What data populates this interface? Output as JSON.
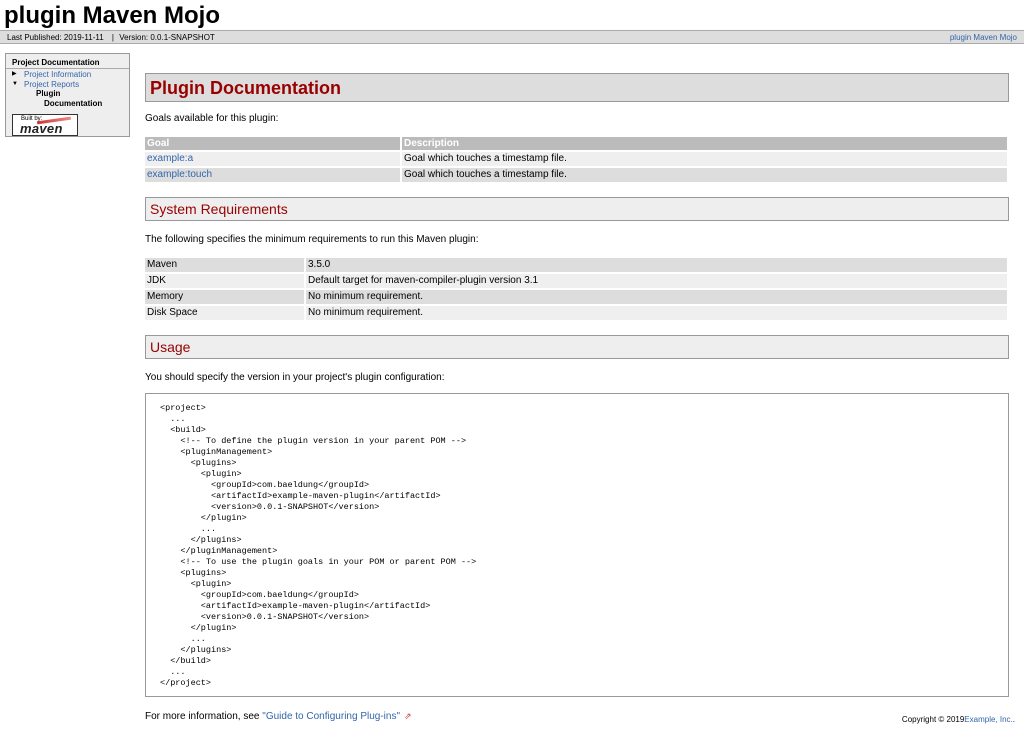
{
  "banner": {
    "title": "plugin Maven Mojo"
  },
  "breadcrumbs": {
    "published": "Last Published: 2019-11-11",
    "separator": "|",
    "version": "Version: 0.0.1-SNAPSHOT",
    "right_link": "plugin Maven Mojo"
  },
  "nav": {
    "heading": "Project Documentation",
    "items": [
      {
        "label": "Project Information",
        "expanded": false
      },
      {
        "label": "Project Reports",
        "expanded": true
      }
    ],
    "sub_line1": "Plugin",
    "sub_line2": "Documentation",
    "powered_small": "Built by:",
    "powered_big": "maven"
  },
  "content": {
    "title": "Plugin Documentation",
    "goals_intro": "Goals available for this plugin:",
    "goals_table": {
      "headers": [
        "Goal",
        "Description"
      ],
      "rows": [
        {
          "goal": "example:a",
          "description": "Goal which touches a timestamp file."
        },
        {
          "goal": "example:touch",
          "description": "Goal which touches a timestamp file."
        }
      ]
    },
    "sysreq_title": "System Requirements",
    "sysreq_intro": "The following specifies the minimum requirements to run this Maven plugin:",
    "sysreq_rows": [
      {
        "name": "Maven",
        "value": "3.5.0"
      },
      {
        "name": "JDK",
        "value": "Default target for maven-compiler-plugin version 3.1"
      },
      {
        "name": "Memory",
        "value": "No minimum requirement."
      },
      {
        "name": "Disk Space",
        "value": "No minimum requirement."
      }
    ],
    "usage_title": "Usage",
    "usage_intro": "You should specify the version in your project's plugin configuration:",
    "code": "<project>\n  ...\n  <build>\n    <!-- To define the plugin version in your parent POM -->\n    <pluginManagement>\n      <plugins>\n        <plugin>\n          <groupId>com.baeldung</groupId>\n          <artifactId>example-maven-plugin</artifactId>\n          <version>0.0.1-SNAPSHOT</version>\n        </plugin>\n        ...\n      </plugins>\n    </pluginManagement>\n    <!-- To use the plugin goals in your POM or parent POM -->\n    <plugins>\n      <plugin>\n        <groupId>com.baeldung</groupId>\n        <artifactId>example-maven-plugin</artifactId>\n        <version>0.0.1-SNAPSHOT</version>\n      </plugin>\n      ...\n    </plugins>\n  </build>\n  ...\n</project>",
    "more_prefix": "For more information, see ",
    "more_link": "\"Guide to Configuring Plug-ins\"",
    "external_icon": "external-link-icon"
  },
  "footer": {
    "copyright": "Copyright © 2019",
    "company_link": "Example, Inc.",
    "suffix": "."
  }
}
